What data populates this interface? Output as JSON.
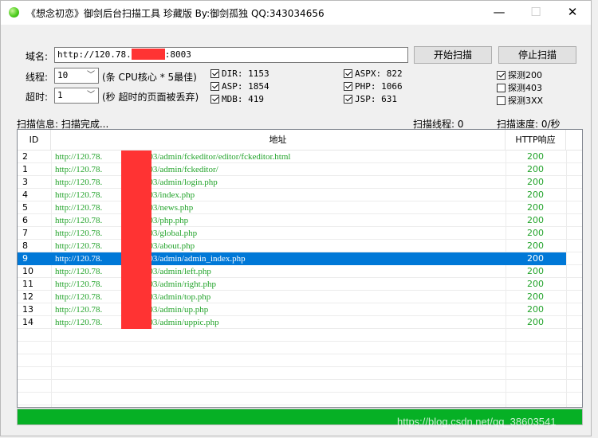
{
  "window": {
    "title": "《想念初恋》御剑后台扫描工具 珍藏版 By:御剑孤独 QQ:343034656",
    "min_glyph": "—",
    "max_glyph": "☐",
    "close_glyph": "✕"
  },
  "form": {
    "domain_label": "域名:",
    "domain_prefix": "http://120.78.",
    "domain_suffix": ":8003",
    "start_button": "开始扫描",
    "stop_button": "停止扫描",
    "threads_label": "线程:",
    "threads_value": "10",
    "threads_hint": "(条 CPU核心 * 5最佳)",
    "timeout_label": "超时:",
    "timeout_value": "1",
    "timeout_hint": "(秒 超时的页面被丢弃)"
  },
  "dicts": [
    {
      "label": "DIR: 1153",
      "checked": true
    },
    {
      "label": "ASP: 1854",
      "checked": true
    },
    {
      "label": "MDB: 419",
      "checked": true
    },
    {
      "label": "ASPX: 822",
      "checked": true
    },
    {
      "label": "PHP: 1066",
      "checked": true
    },
    {
      "label": "JSP: 631",
      "checked": true
    },
    {
      "label": "探测200",
      "checked": true
    },
    {
      "label": "探测403",
      "checked": false
    },
    {
      "label": "探测3XX",
      "checked": false
    }
  ],
  "status": {
    "info": "扫描信息: 扫描完成...",
    "threads": "扫描线程: 0",
    "speed": "扫描速度: 0/秒"
  },
  "table": {
    "headers": [
      "ID",
      "地址",
      "HTTP响应"
    ],
    "url_prefix": "http://120.78.",
    "rows": [
      {
        "id": "2",
        "path": ":8003/admin/fckeditor/editor/fckeditor.html",
        "code": "200"
      },
      {
        "id": "1",
        "path": ":8003/admin/fckeditor/",
        "code": "200"
      },
      {
        "id": "3",
        "path": ":8003/admin/login.php",
        "code": "200"
      },
      {
        "id": "4",
        "path": ":8003/index.php",
        "code": "200"
      },
      {
        "id": "5",
        "path": ":8003/news.php",
        "code": "200"
      },
      {
        "id": "6",
        "path": ":8003/php.php",
        "code": "200"
      },
      {
        "id": "7",
        "path": ":8003/global.php",
        "code": "200"
      },
      {
        "id": "8",
        "path": ":8003/about.php",
        "code": "200"
      },
      {
        "id": "9",
        "path": ":8003/admin/admin_index.php",
        "code": "200",
        "selected": true
      },
      {
        "id": "10",
        "path": ":8003/admin/left.php",
        "code": "200"
      },
      {
        "id": "11",
        "path": ":8003/admin/right.php",
        "code": "200"
      },
      {
        "id": "12",
        "path": ":8003/admin/top.php",
        "code": "200"
      },
      {
        "id": "13",
        "path": ":8003/admin/up.php",
        "code": "200"
      },
      {
        "id": "14",
        "path": ":8003/admin/uppic.php",
        "code": "200"
      }
    ]
  },
  "progress": {
    "value_percent": 100,
    "color": "#06b025"
  },
  "colors": {
    "url_text": "#22a32a",
    "selection": "#0078d7",
    "redaction": "#ff3333"
  },
  "watermark": "https://blog.csdn.net/qq_38603541"
}
